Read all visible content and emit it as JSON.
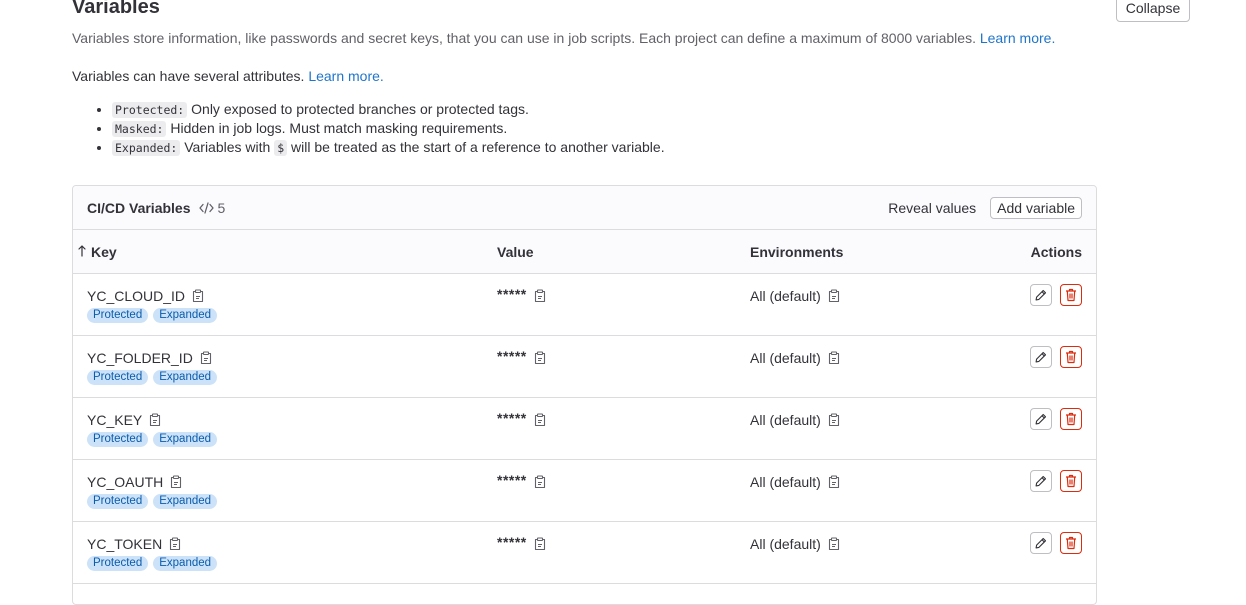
{
  "page": {
    "title": "Variables",
    "collapse_label": "Collapse",
    "description": "Variables store information, like passwords and secret keys, that you can use in job scripts. Each project can define a maximum of 8000 variables.",
    "description_link": "Learn more.",
    "attributes_intro": "Variables can have several attributes.",
    "attributes_link": "Learn more.",
    "attributes": [
      {
        "code": "Protected:",
        "text": "Only exposed to protected branches or protected tags."
      },
      {
        "code": "Masked:",
        "text": "Hidden in job logs. Must match masking requirements."
      },
      {
        "code": "Expanded:",
        "text_before": "Variables with",
        "inline_code": "$",
        "text_after": "will be treated as the start of a reference to another variable."
      }
    ]
  },
  "card": {
    "title": "CI/CD Variables",
    "count_icon": "code-icon",
    "count": "5",
    "reveal_label": "Reveal values",
    "add_label": "Add variable",
    "columns": {
      "key": "Key",
      "value": "Value",
      "environments": "Environments",
      "actions": "Actions"
    },
    "sort_icon": "arrow-up-icon",
    "rows": [
      {
        "key": "YC_CLOUD_ID",
        "badges": [
          "Protected",
          "Expanded"
        ],
        "value": "*****",
        "env": "All (default)"
      },
      {
        "key": "YC_FOLDER_ID",
        "badges": [
          "Protected",
          "Expanded"
        ],
        "value": "*****",
        "env": "All (default)"
      },
      {
        "key": "YC_KEY",
        "badges": [
          "Protected",
          "Expanded"
        ],
        "value": "*****",
        "env": "All (default)"
      },
      {
        "key": "YC_OAUTH",
        "badges": [
          "Protected",
          "Expanded"
        ],
        "value": "*****",
        "env": "All (default)"
      },
      {
        "key": "YC_TOKEN",
        "badges": [
          "Protected",
          "Expanded"
        ],
        "value": "*****",
        "env": "All (default)"
      }
    ]
  },
  "colors": {
    "link": "#1f75cb",
    "badge_bg": "#cbe2f9",
    "badge_text": "#0b5cad",
    "danger": "#dd2b0e"
  }
}
